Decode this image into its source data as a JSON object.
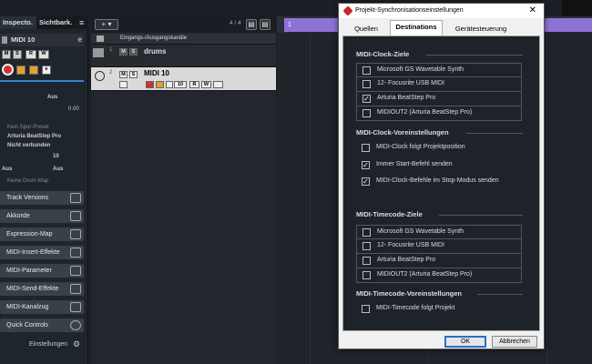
{
  "inspector": {
    "tabs": [
      "Inspecto.",
      "Sichtbark."
    ],
    "track_name": "MIDI 10",
    "out_label": "Aus",
    "volume_value": "0.00",
    "no_track_preset": "Kein Spur-Preset",
    "output_device": "Arturia BeatStep Pro",
    "not_connected": "Nicht verbunden",
    "channel": "10",
    "bank_left": "Aus",
    "bank_right": "Aus",
    "no_drum_map": "Keine Drum-Map",
    "sections": [
      "Track Versions",
      "Akkorde",
      "Expression-Map",
      "MIDI-Insert-Effekte",
      "MIDI-Parameter",
      "MIDI-Send-Effekte",
      "MIDI-Kanalzug",
      "Quick Controls"
    ],
    "settings": "Einstellungen"
  },
  "tracks": {
    "add": "+",
    "dropdown": "▾",
    "count": "4 / 4",
    "header": "Eingangs-/Ausgangskanäle",
    "items": [
      {
        "num": "1",
        "name": "drums"
      },
      {
        "num": "2",
        "name": "MIDI 10",
        "channel": "10"
      }
    ]
  },
  "arranger": {
    "marker": "1"
  },
  "dialog": {
    "title": "Projekt-Synchronisationseinstellungen",
    "tabs": [
      "Quellen",
      "Destinations",
      "Geräte­steuerung"
    ],
    "active_tab": "Destinations",
    "groups": {
      "clock_targets": {
        "title": "MIDI-Clock-Ziele",
        "items": [
          {
            "label": "Microsoft GS Wavetable Synth",
            "checked": false
          },
          {
            "label": "12- Focusrite USB MIDI",
            "checked": false
          },
          {
            "label": "Arturia BeatStep Pro",
            "checked": true
          },
          {
            "label": "MIDIOUT2 (Arturia BeatStep Pro)",
            "checked": false
          }
        ]
      },
      "clock_prefs": {
        "title": "MIDI-Clock-Voreinstellungen",
        "items": [
          {
            "label": "MIDI-Clock folgt Projektposition",
            "checked": false
          },
          {
            "label": "Immer Start-Befehl senden",
            "checked": true
          },
          {
            "label": "MIDI-Clock-Befehle im Stop-Modus senden",
            "checked": true
          }
        ]
      },
      "timecode_targets": {
        "title": "MIDI-Timecode-Ziele",
        "items": [
          {
            "label": "Microsoft GS Wavetable Synth",
            "checked": false
          },
          {
            "label": "12- Focusrite USB MIDI",
            "checked": false
          },
          {
            "label": "Arturia BeatStep Pro",
            "checked": false
          },
          {
            "label": "MIDIOUT2 (Arturia BeatStep Pro)",
            "checked": false
          }
        ]
      },
      "timecode_prefs": {
        "title": "MIDI-Timecode-Voreinstellungen",
        "items": [
          {
            "label": "MIDI-Timecode folgt Projekt",
            "checked": false
          }
        ]
      }
    },
    "ok": "OK",
    "cancel": "Abbrechen"
  },
  "colors": {
    "cycle": "#8d73d6",
    "accent": "#2b6fc6",
    "record": "#d03030"
  }
}
